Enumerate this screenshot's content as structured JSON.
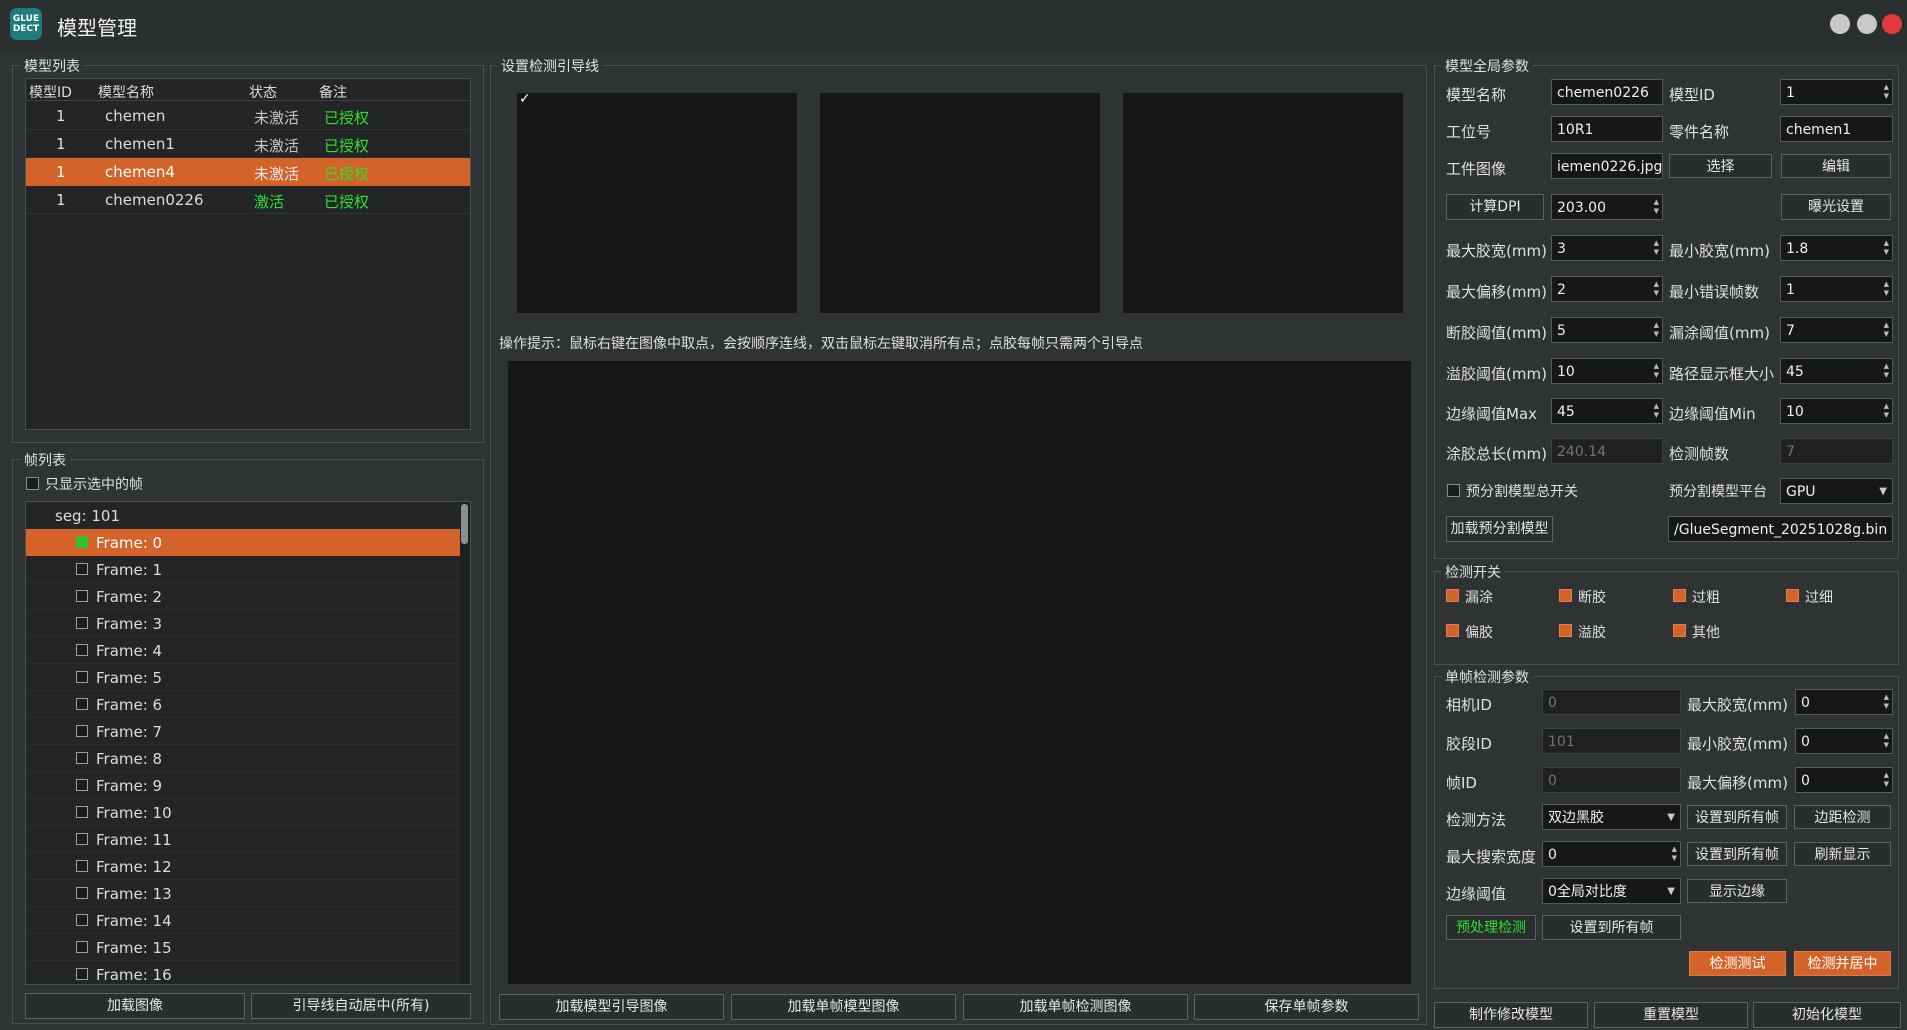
{
  "app": {
    "title": "模型管理",
    "logo_text": "GLUE DECT",
    "accent": "#d4632a",
    "bg": "#2f3334"
  },
  "model_list": {
    "title": "模型列表",
    "columns": [
      "模型ID",
      "模型名称",
      "状态",
      "备注"
    ],
    "rows": [
      {
        "id": "1",
        "name": "chemen",
        "status": "未激活",
        "note": "已授权"
      },
      {
        "id": "1",
        "name": "chemen1",
        "status": "未激活",
        "note": "已授权"
      },
      {
        "id": "1",
        "name": "chemen4",
        "status": "未激活",
        "note": "已授权"
      },
      {
        "id": "1",
        "name": "chemen0226",
        "status": "激活",
        "note": "已授权"
      }
    ],
    "selected_index": 2
  },
  "frame_list": {
    "title": "帧列表",
    "only_selected_label": "只显示选中的帧",
    "seg_label": "seg: 101",
    "frames": [
      "Frame: 0",
      "Frame: 1",
      "Frame: 2",
      "Frame: 3",
      "Frame: 4",
      "Frame: 5",
      "Frame: 6",
      "Frame: 7",
      "Frame: 8",
      "Frame: 9",
      "Frame: 10",
      "Frame: 11",
      "Frame: 12",
      "Frame: 13",
      "Frame: 14",
      "Frame: 15",
      "Frame: 16"
    ],
    "selected_frame": 0,
    "load_image_btn": "加载图像",
    "auto_center_btn": "引导线自动居中(所有)"
  },
  "guide": {
    "title": "设置检测引导线",
    "check_mark": "✓",
    "hint": "操作提示：鼠标右键在图像中取点，会按顺序连线，双击鼠标左键取消所有点；点胶每帧只需两个引导点",
    "buttons": [
      "加载模型引导图像",
      "加载单帧模型图像",
      "加载单帧检测图像",
      "保存单帧参数"
    ]
  },
  "global_params": {
    "title": "模型全局参数",
    "model_name_label": "模型名称",
    "model_name": "chemen0226",
    "model_id_label": "模型ID",
    "model_id": "1",
    "station_label": "工位号",
    "station": "10R1",
    "part_name_label": "零件名称",
    "part_name": "chemen1",
    "part_image_label": "工件图像",
    "part_image": "iemen0226.jpg",
    "select_btn": "选择",
    "edit_btn": "编辑",
    "calc_dpi_btn": "计算DPI",
    "dpi": "203.00",
    "exposure_btn": "曝光设置",
    "max_glue_width_label": "最大胶宽(mm)",
    "max_glue_width": "3",
    "min_glue_width_label": "最小胶宽(mm)",
    "min_glue_width": "1.8",
    "max_offset_label": "最大偏移(mm)",
    "max_offset": "2",
    "min_error_frames_label": "最小错误帧数",
    "min_error_frames": "1",
    "break_thresh_label": "断胶阈值(mm)",
    "break_thresh": "5",
    "leak_thresh_label": "漏涂阈值(mm)",
    "leak_thresh": "7",
    "overflow_thresh_label": "溢胶阈值(mm)",
    "overflow_thresh": "10",
    "path_box_label": "路径显示框大小",
    "path_box": "45",
    "edge_max_label": "边缘阈值Max",
    "edge_max": "45",
    "edge_min_label": "边缘阈值Min",
    "edge_min": "10",
    "total_len_label": "涂胶总长(mm)",
    "total_len": "240.14",
    "detect_frames_label": "检测帧数",
    "detect_frames": "7",
    "preseg_switch_label": "预分割模型总开关",
    "preseg_platform_label": "预分割模型平台",
    "preseg_platform": "GPU",
    "load_preseg_btn": "加载预分割模型",
    "preseg_path": "/GlueSegment_20251028g.bin"
  },
  "detect_switches": {
    "title": "检测开关",
    "items": [
      "漏涂",
      "断胶",
      "过粗",
      "过细",
      "偏胶",
      "溢胶",
      "其他"
    ]
  },
  "single_frame": {
    "title": "单帧检测参数",
    "camera_id_label": "相机ID",
    "camera_id": "0",
    "max_width_label": "最大胶宽(mm)",
    "max_width": "0",
    "seg_id_label": "胶段ID",
    "seg_id": "101",
    "min_width_label": "最小胶宽(mm)",
    "min_width": "0",
    "frame_id_label": "帧ID",
    "frame_id": "0",
    "max_offset_label": "最大偏移(mm)",
    "max_offset": "0",
    "method_label": "检测方法",
    "method": "双边黑胶",
    "set_all_btn": "设置到所有帧",
    "edge_detect_btn": "边距检测",
    "max_search_label": "最大搜索宽度",
    "max_search": "0",
    "refresh_btn": "刷新显示",
    "edge_thresh_label": "边缘阈值",
    "edge_thresh": "0全局对比度",
    "show_edge_btn": "显示边缘",
    "preprocess_btn": "预处理检测",
    "detect_test_btn": "检测测试",
    "detect_center_btn": "检测并居中"
  },
  "bottom": {
    "make_btn": "制作修改模型",
    "reset_btn": "重置模型",
    "init_btn": "初始化模型"
  }
}
